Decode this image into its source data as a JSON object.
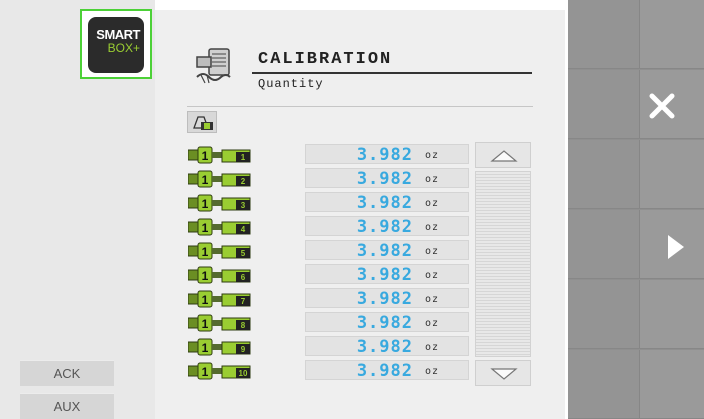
{
  "logo": {
    "line1": "SMART",
    "line2": "BOX+"
  },
  "header": {
    "title": "CALIBRATION",
    "subtitle": "Quantity"
  },
  "side_buttons": {
    "ack": "ACK",
    "aux": "AUX"
  },
  "unit": "oz",
  "value_color": "#38a9df",
  "rows": [
    {
      "section": "1",
      "value": "3.982"
    },
    {
      "section": "2",
      "value": "3.982"
    },
    {
      "section": "3",
      "value": "3.982"
    },
    {
      "section": "4",
      "value": "3.982"
    },
    {
      "section": "5",
      "value": "3.982"
    },
    {
      "section": "6",
      "value": "3.982"
    },
    {
      "section": "7",
      "value": "3.982"
    },
    {
      "section": "8",
      "value": "3.982"
    },
    {
      "section": "9",
      "value": "3.982"
    },
    {
      "section": "10",
      "value": "3.982"
    }
  ],
  "softkeys": [
    {
      "icon": ""
    },
    {
      "icon": "close-icon"
    },
    {
      "icon": ""
    },
    {
      "icon": "play-icon"
    },
    {
      "icon": ""
    },
    {
      "icon": ""
    }
  ]
}
